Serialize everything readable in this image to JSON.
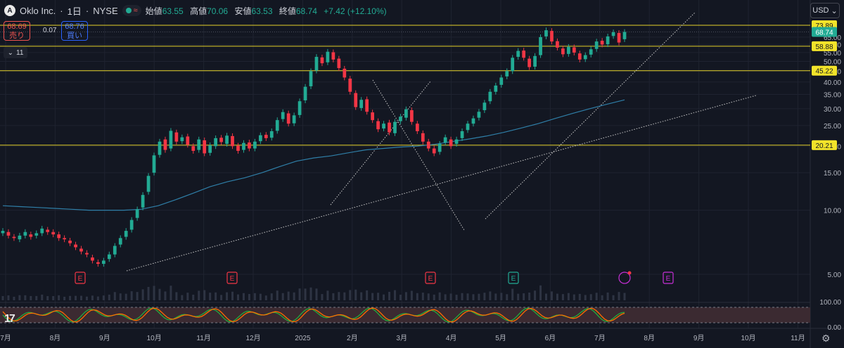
{
  "header": {
    "logo_letter": "A",
    "symbol": "Oklo Inc.",
    "dot_sep": "·",
    "interval": "1日",
    "exchange": "NYSE",
    "ohlc": [
      {
        "label": "始値",
        "value": "63.55"
      },
      {
        "label": "高値",
        "value": "70.06"
      },
      {
        "label": "安値",
        "value": "63.53"
      },
      {
        "label": "終値",
        "value": "68.74"
      }
    ],
    "change": "+7.42 (+12.10%)"
  },
  "trade": {
    "sell_price": "68.69",
    "sell_label": "売り",
    "spread": "0.07",
    "buy_price": "68.76",
    "buy_label": "買い"
  },
  "indicators_toggle": {
    "count": "11"
  },
  "currency": {
    "label": "USD"
  },
  "chart_data": {
    "type": "candlestick",
    "x_ticks": [
      "7月",
      "8月",
      "9月",
      "10月",
      "11月",
      "12月",
      "2025",
      "2月",
      "3月",
      "4月",
      "5月",
      "6月",
      "7月",
      "8月",
      "9月",
      "10月",
      "11月"
    ],
    "y_ticks": [
      "5.00",
      "10.00",
      "15.00",
      "20.00",
      "25.00",
      "30.00",
      "35.00",
      "40.00",
      "45.00",
      "50.00",
      "55.00",
      "60.00",
      "65.00"
    ],
    "y_scale": "log",
    "horizontal_levels": [
      "73.89",
      "58.88",
      "45.22",
      "20.21"
    ],
    "last_price": "68.74",
    "earnings_markers": [
      "E",
      "E",
      "E",
      "E",
      "E"
    ],
    "oscillator_ticks": [
      "100.00",
      "0.00"
    ],
    "candles": [
      [
        7.8,
        8.0
      ],
      [
        7.9,
        7.6
      ],
      [
        7.5,
        7.4
      ],
      [
        7.3,
        7.6
      ],
      [
        7.6,
        7.9
      ],
      [
        7.7,
        7.5
      ],
      [
        7.6,
        7.8
      ],
      [
        7.8,
        8.2
      ],
      [
        8.1,
        7.9
      ],
      [
        7.9,
        7.7
      ],
      [
        7.7,
        7.4
      ],
      [
        7.4,
        7.3
      ],
      [
        7.2,
        7.0
      ],
      [
        6.9,
        6.7
      ],
      [
        6.6,
        6.4
      ],
      [
        6.3,
        6.2
      ],
      [
        6.0,
        5.8
      ],
      [
        5.7,
        5.6
      ],
      [
        5.6,
        5.8
      ],
      [
        5.9,
        6.2
      ],
      [
        6.2,
        6.8
      ],
      [
        6.9,
        7.4
      ],
      [
        7.5,
        8.0
      ],
      [
        8.1,
        9.0
      ],
      [
        9.2,
        10.1
      ],
      [
        10.3,
        11.8
      ],
      [
        12.2,
        14.5
      ],
      [
        15.0,
        18.1
      ],
      [
        18.2,
        21.0
      ],
      [
        21.5,
        19.2
      ],
      [
        19.5,
        23.6
      ],
      [
        23.2,
        21.0
      ],
      [
        21.1,
        22.0
      ],
      [
        22.2,
        20.3
      ],
      [
        20.0,
        19.0
      ],
      [
        19.2,
        21.5
      ],
      [
        21.3,
        18.5
      ],
      [
        18.6,
        20.2
      ],
      [
        20.0,
        21.8
      ],
      [
        21.9,
        20.9
      ],
      [
        20.5,
        22.4
      ],
      [
        22.3,
        20.0
      ],
      [
        20.1,
        19.0
      ],
      [
        19.2,
        20.7
      ],
      [
        20.8,
        19.5
      ],
      [
        19.5,
        21.0
      ],
      [
        21.1,
        22.5
      ],
      [
        22.6,
        21.8
      ],
      [
        21.9,
        23.5
      ],
      [
        23.6,
        26.5
      ],
      [
        26.8,
        28.9
      ],
      [
        28.5,
        25.5
      ],
      [
        25.6,
        27.9
      ],
      [
        28.0,
        32.5
      ],
      [
        32.8,
        38.0
      ],
      [
        38.2,
        45.0
      ],
      [
        45.3,
        52.5
      ],
      [
        52.2,
        49.0
      ],
      [
        49.5,
        55.5
      ],
      [
        55.2,
        51.0
      ],
      [
        51.5,
        46.5
      ],
      [
        46.2,
        42.0
      ],
      [
        41.5,
        36.0
      ],
      [
        35.5,
        30.5
      ],
      [
        30.2,
        33.0
      ],
      [
        33.2,
        29.0
      ],
      [
        28.8,
        26.5
      ],
      [
        26.2,
        24.0
      ],
      [
        24.2,
        25.5
      ],
      [
        25.8,
        23.2
      ],
      [
        23.0,
        26.0
      ],
      [
        26.2,
        27.5
      ],
      [
        27.2,
        29.8
      ],
      [
        29.5,
        26.0
      ],
      [
        25.5,
        23.5
      ],
      [
        23.0,
        21.0
      ],
      [
        21.0,
        19.5
      ],
      [
        19.5,
        18.5
      ],
      [
        18.8,
        20.5
      ],
      [
        20.8,
        22.0
      ],
      [
        21.5,
        20.0
      ],
      [
        20.5,
        21.5
      ],
      [
        21.8,
        23.5
      ],
      [
        23.8,
        25.5
      ],
      [
        25.5,
        27.0
      ],
      [
        27.2,
        29.0
      ],
      [
        29.5,
        32.0
      ],
      [
        32.5,
        36.0
      ],
      [
        36.0,
        38.5
      ],
      [
        38.8,
        42.0
      ],
      [
        42.5,
        45.0
      ],
      [
        45.0,
        52.0
      ],
      [
        52.5,
        56.0
      ],
      [
        56.2,
        52.0
      ],
      [
        51.5,
        47.0
      ],
      [
        47.2,
        53.0
      ],
      [
        53.5,
        65.0
      ],
      [
        65.5,
        70.0
      ],
      [
        69.5,
        62.0
      ],
      [
        62.2,
        58.0
      ],
      [
        57.5,
        54.0
      ],
      [
        54.2,
        58.5
      ],
      [
        58.2,
        55.0
      ],
      [
        54.5,
        51.0
      ],
      [
        51.2,
        53.5
      ],
      [
        53.8,
        57.0
      ],
      [
        57.2,
        62.0
      ],
      [
        62.5,
        60.0
      ],
      [
        60.2,
        65.5
      ],
      [
        65.8,
        68.5
      ],
      [
        68.0,
        61.3
      ],
      [
        63.55,
        68.74
      ]
    ],
    "ma_series": [
      10.5,
      10.4,
      10.3,
      10.2,
      10.1,
      10.0,
      10.0,
      10.0,
      10.1,
      10.5,
      11.2,
      12.0,
      12.9,
      13.6,
      14.2,
      15.0,
      16.0,
      17.0,
      17.6,
      18.0,
      18.6,
      19.2,
      19.5,
      19.8,
      20.0,
      20.4,
      21.0,
      21.6,
      22.3,
      23.2,
      24.3,
      25.5,
      27.0,
      28.5,
      30.0,
      31.5,
      33.0
    ],
    "oscillator": {
      "upper": "80",
      "lower": "20"
    }
  }
}
